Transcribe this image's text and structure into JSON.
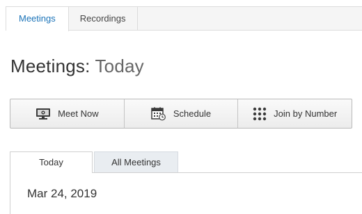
{
  "top_tabs": [
    {
      "label": "Meetings",
      "active": true
    },
    {
      "label": "Recordings",
      "active": false
    }
  ],
  "page_title": {
    "prefix": "Meetings:",
    "suffix": " Today"
  },
  "actions": [
    {
      "label": "Meet Now",
      "icon": "monitor-icon"
    },
    {
      "label": "Schedule",
      "icon": "calendar-clock-icon"
    },
    {
      "label": "Join by Number",
      "icon": "keypad-icon"
    }
  ],
  "sub_tabs": [
    {
      "label": "Today",
      "active": true
    },
    {
      "label": "All Meetings",
      "active": false
    }
  ],
  "current_date": "Mar 24, 2019",
  "colors": {
    "accent": "#1a73b8",
    "text": "#333333"
  }
}
